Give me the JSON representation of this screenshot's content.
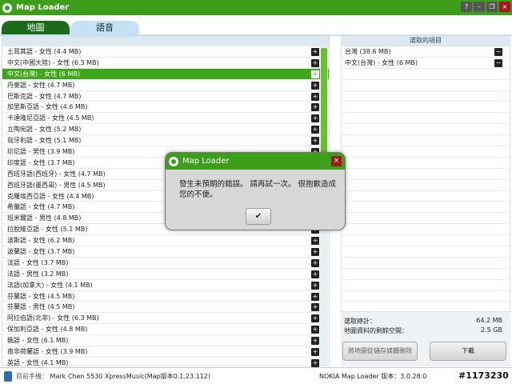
{
  "window": {
    "title": "Map Loader",
    "controls": [
      "?",
      "–",
      "❐",
      "×"
    ]
  },
  "tabs": [
    {
      "label": "地圖",
      "active": true
    },
    {
      "label": "語音",
      "active": false
    }
  ],
  "voices": [
    {
      "label": "土耳其語 - 女性 (4.4 MB)"
    },
    {
      "label": "中文(中國大陸) - 女性 (6.3 MB)"
    },
    {
      "label": "中文(台灣) - 女性 (6 MB)",
      "selected": true
    },
    {
      "label": "丹麥語 - 女性 (4.7 MB)"
    },
    {
      "label": "巴斯克語 - 女性 (4.7 MB)"
    },
    {
      "label": "加里斯亞語 - 女性 (4.6 MB)"
    },
    {
      "label": "卡達隆尼亞語 - 女性 (4.5 MB)"
    },
    {
      "label": "立陶宛語 - 女性 (5.2 MB)"
    },
    {
      "label": "匈牙利語 - 女性 (5.1 MB)"
    },
    {
      "label": "印尼語 - 男性 (3.9 MB)"
    },
    {
      "label": "印度語 - 女性 (3.7 MB)"
    },
    {
      "label": "西班牙語(西班牙) - 女性 (4.7 MB)"
    },
    {
      "label": "西班牙語(墨西哥) - 男性 (4.5 MB)"
    },
    {
      "label": "克羅埃西亞語 - 女性 (4.4 MB)"
    },
    {
      "label": "希臘語 - 女性 (4.7 MB)"
    },
    {
      "label": "班米爾語 - 男性 (4.8 MB)"
    },
    {
      "label": "拉脫維亞語 - 女性 (5.1 MB)"
    },
    {
      "label": "波斯語 - 女性 (6.2 MB)"
    },
    {
      "label": "波蘭語 - 女性 (3.7 MB)"
    },
    {
      "label": "法語 - 女性 (3.7 MB)"
    },
    {
      "label": "法語 - 男性 (3.2 MB)"
    },
    {
      "label": "法語(加拿大) - 女性 (4.1 MB)"
    },
    {
      "label": "芬蘭語 - 女性 (4.5 MB)"
    },
    {
      "label": "芬蘭語 - 男性 (4.5 MB)"
    },
    {
      "label": "阿拉伯語(北非) - 女性 (6.3 MB)"
    },
    {
      "label": "保加利亞語 - 女性 (4.8 MB)"
    },
    {
      "label": "俄語 - 女性 (6.1 MB)"
    },
    {
      "label": "南非荷蘭語 - 女性 (3.9 MB)"
    },
    {
      "label": "英語 - 女性 (4.1 MB)"
    }
  ],
  "selected_panel": {
    "header": "選取的項目",
    "items": [
      {
        "label": "台灣 (38.6 MB)"
      },
      {
        "label": "中文(台灣) - 女性 (6 MB)"
      }
    ]
  },
  "summary": {
    "total_label": "選取總計：",
    "total_value": "64.2 MB",
    "free_label": "地圖資料的剩餘空間：",
    "free_value": "2.5 GB",
    "remove_button": "將地圖從儲存媒體刪除",
    "download_button": "下載"
  },
  "status": {
    "phone_label": "目前手機：",
    "phone_value": "Mark Chen 5530 XpressMusic(Map版本0.1.23.112)",
    "app_version": "NOKIA Map Loader 版本：3.0.28.0",
    "watermark": "#1173230"
  },
  "dialog": {
    "title": "Map Loader",
    "message": "發生未預期的錯誤。 請再試一次。 很抱歉造成您的不便。",
    "ok_label": "✔",
    "close_label": "×"
  },
  "colors": {
    "brand_green": "#3d9e1a",
    "tab_dark_green": "#1b6b1b",
    "tab_light_blue": "#c6e1f3",
    "close_red": "#a31919"
  }
}
